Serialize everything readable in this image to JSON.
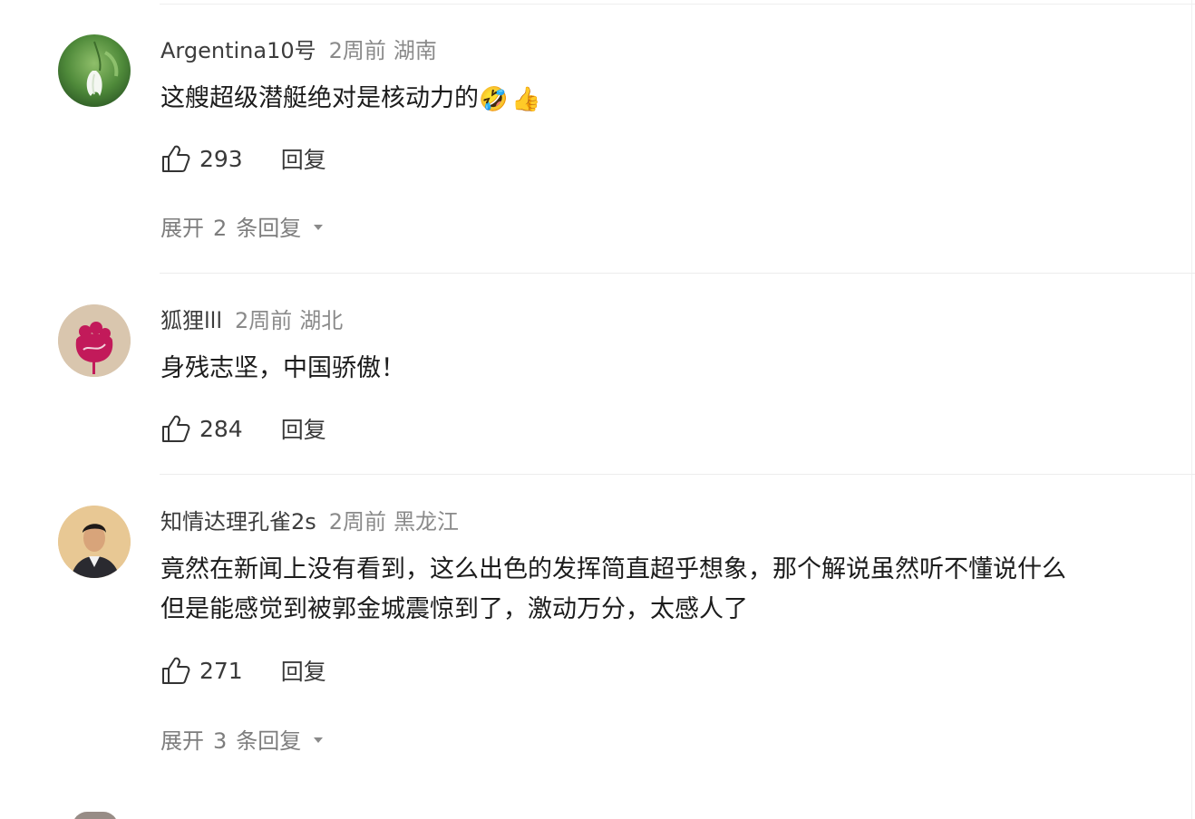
{
  "comments": [
    {
      "username": "Argentina10号",
      "time": "2周前",
      "location": "湖南",
      "text": "这艘超级潜艇绝对是核动力的",
      "emojis": [
        "🤣",
        "👍"
      ],
      "likes": "293",
      "reply_label": "回复",
      "expand": {
        "prefix": "展开",
        "count": "2",
        "suffix": "条回复"
      }
    },
    {
      "username": "狐狸lll",
      "time": "2周前",
      "location": "湖北",
      "text": "身残志坚，中国骄傲！",
      "likes": "284",
      "reply_label": "回复"
    },
    {
      "username": "知情达理孔雀2s",
      "time": "2周前",
      "location": "黑龙江",
      "text_line1": "竟然在新闻上没有看到，这么出色的发挥简直超乎想象，那个解说虽然听不懂说什么",
      "text_line2": "但是能感觉到被郭金城震惊到了，激动万分，太感人了",
      "likes": "271",
      "reply_label": "回复",
      "expand": {
        "prefix": "展开",
        "count": "3",
        "suffix": "条回复"
      }
    }
  ],
  "icons": {
    "like": "thumbs-up-outline-icon",
    "expand": "caret-down-icon"
  },
  "colors": {
    "username": "#3c3c3c",
    "meta": "#8a8a8a",
    "text": "#1c1c1c",
    "divider": "#ececec"
  }
}
